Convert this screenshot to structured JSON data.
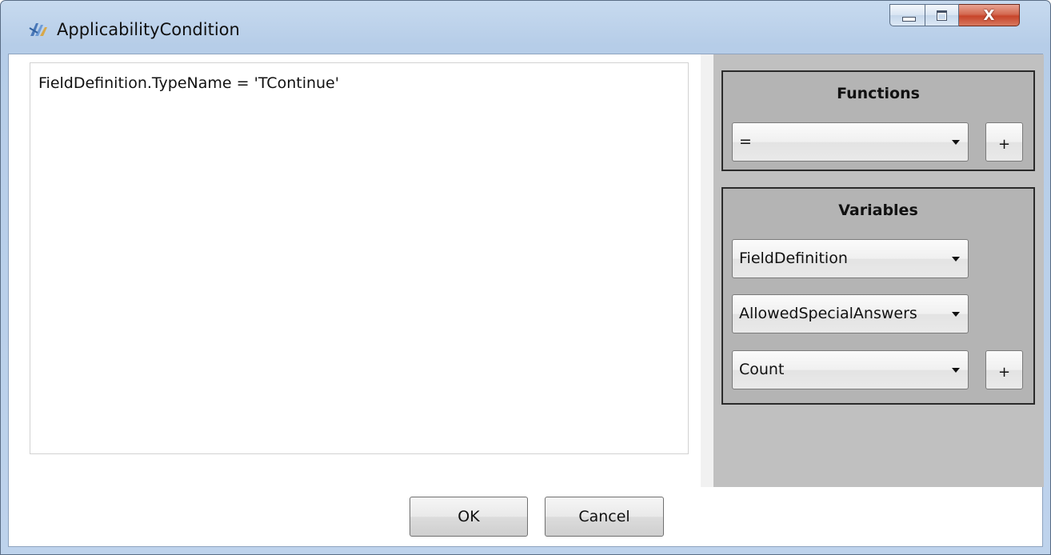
{
  "window": {
    "title": "ApplicabilityCondition",
    "icon": "applicability-condition-icon",
    "controls": {
      "minimize": "minimize-icon",
      "maximize": "maximize-icon",
      "close": "close-icon",
      "close_glyph": "X"
    }
  },
  "editor": {
    "text": "FieldDefinition.TypeName = 'TContinue'"
  },
  "functions": {
    "title": "Functions",
    "selected": "=",
    "add_label": "+"
  },
  "variables": {
    "title": "Variables",
    "combos": [
      {
        "selected": "FieldDefinition"
      },
      {
        "selected": "AllowedSpecialAnswers"
      },
      {
        "selected": "Count"
      }
    ],
    "add_label": "+"
  },
  "footer": {
    "ok_label": "OK",
    "cancel_label": "Cancel"
  },
  "colors": {
    "frame": "#bed3ec",
    "panel": "#c0c0c0",
    "group": "#b4b4b4",
    "close_button": "#c7442a"
  }
}
